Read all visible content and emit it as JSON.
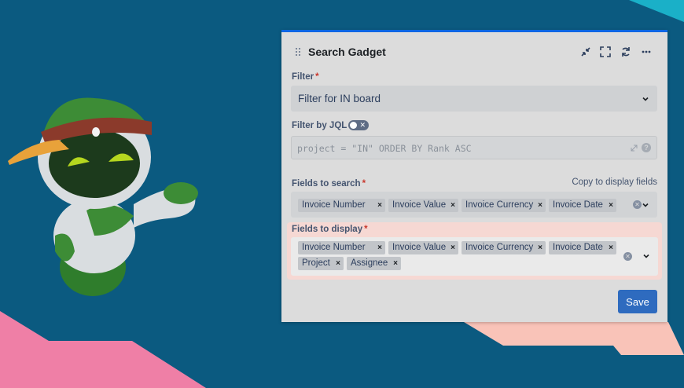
{
  "colors": {
    "background": "#0b5a80",
    "accent": "#0c66e4",
    "required": "#c9372c",
    "highlight": "#f6d8d3",
    "save": "#2e6bbf"
  },
  "gadget": {
    "title": "Search Gadget",
    "icons": [
      "drag-handle-icon",
      "minimize-icon",
      "fullscreen-icon",
      "refresh-icon",
      "more-icon"
    ]
  },
  "filter": {
    "label": "Filter",
    "required_mark": "*",
    "value": "Filter for IN board"
  },
  "jql": {
    "label": "Filter by JQL",
    "toggle_mark": "✕",
    "query": "project = \"IN\" ORDER BY Rank ASC"
  },
  "fields_to_search": {
    "label": "Fields to search",
    "required_mark": "*",
    "copy_link": "Copy to display fields",
    "tags": [
      "Invoice Number",
      "Invoice Value",
      "Invoice Currency",
      "Invoice Date"
    ]
  },
  "fields_to_display": {
    "label": "Fields to display",
    "required_mark": "*",
    "tags": [
      "Invoice Number",
      "Invoice Value",
      "Invoice Currency",
      "Invoice Date",
      "Project",
      "Assignee"
    ]
  },
  "save": {
    "label": "Save"
  }
}
